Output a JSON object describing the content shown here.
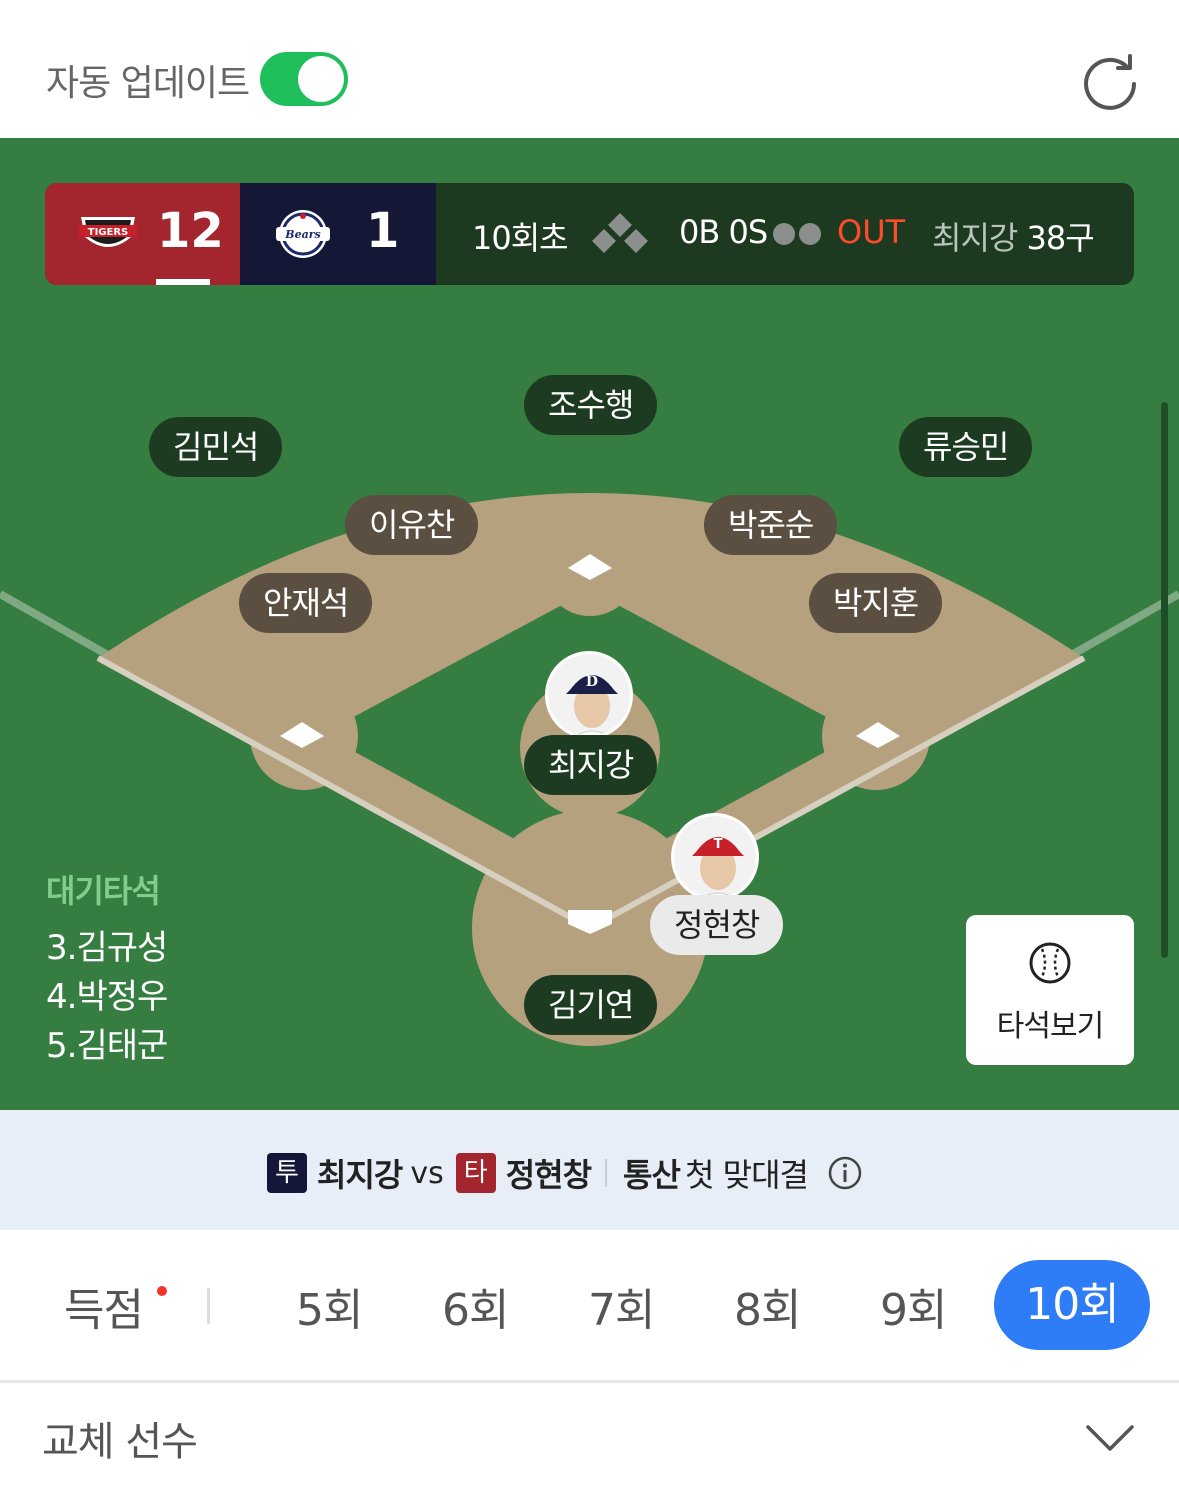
{
  "header": {
    "auto_update_label": "자동 업데이트",
    "auto_update_on": true,
    "refresh_icon": "refresh-icon"
  },
  "scoreboard": {
    "home_team": {
      "logo": "tigers-logo",
      "score": "12",
      "color": "#a3262e"
    },
    "away_team": {
      "logo": "bears-logo",
      "score": "1",
      "color": "#141736"
    },
    "inning": "10회초",
    "count": "0B 0S",
    "outs": 0,
    "out_label": "OUT",
    "pitcher_name": "최지강",
    "pitch_count": "38구"
  },
  "field": {
    "positions": {
      "center_field": "조수행",
      "left_field": "김민석",
      "right_field": "류승민",
      "shortstop": "이유찬",
      "second_base": "박준순",
      "third_base": "안재석",
      "first_base": "박지훈",
      "pitcher": "최지강",
      "catcher": "김기연",
      "batter": "정현창"
    },
    "on_deck": {
      "title": "대기타석",
      "batters": [
        "3.김규성",
        "4.박정우",
        "5.김태군"
      ]
    },
    "view_button_label": "타석보기"
  },
  "matchup": {
    "pitcher_badge": "투",
    "pitcher": "최지강",
    "vs": "vs",
    "batter_badge": "타",
    "batter": "정현창",
    "history_bold": "통산",
    "history": "첫 맞대결"
  },
  "tabs": {
    "items": [
      "득점",
      "5회",
      "6회",
      "7회",
      "8회",
      "9회",
      "10회"
    ],
    "active": "10회"
  },
  "substitutes": {
    "label": "교체 선수"
  },
  "colors": {
    "field_green": "#357d41",
    "dirt": "#b6a17f",
    "accent_blue": "#2e7cf6",
    "toggle_green": "#1fbf5c",
    "out_red": "#ff4a2b"
  }
}
